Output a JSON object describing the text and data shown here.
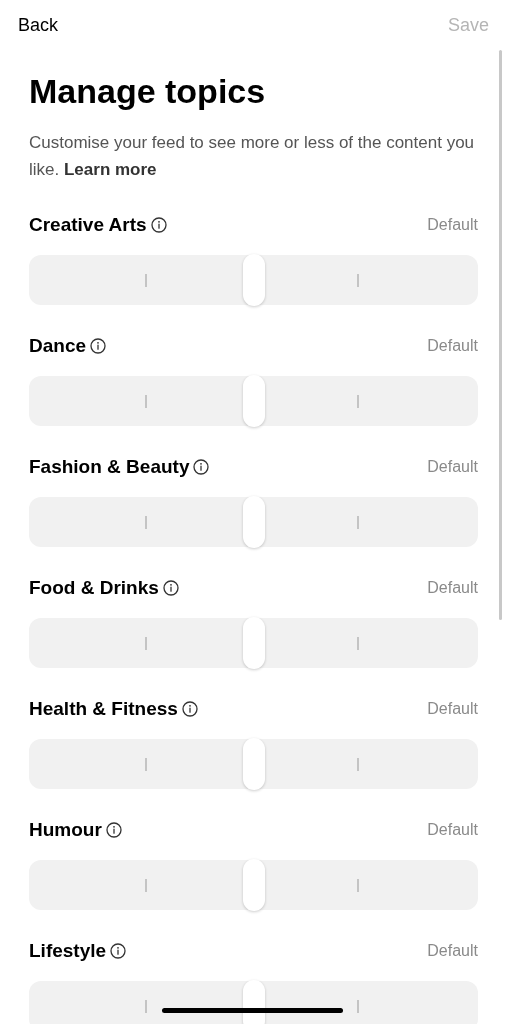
{
  "header": {
    "back": "Back",
    "save": "Save",
    "save_disabled": true
  },
  "title": "Manage topics",
  "description": "Customise your feed to see more or less of the content you like. **Learn more**",
  "topics": [
    {
      "name": "Creative Arts",
      "value": "Default",
      "level": 0.5
    },
    {
      "name": "Dance",
      "value": "Default",
      "level": 0.5
    },
    {
      "name": "Fashion & Beauty",
      "value": "Default",
      "level": 0.5
    },
    {
      "name": "Food & Drinks",
      "value": "Default",
      "level": 0.5
    },
    {
      "name": "Health & Fitness",
      "value": "Default",
      "level": 0.5
    },
    {
      "name": "Humour",
      "value": "Default",
      "level": 0.5
    },
    {
      "name": "Lifestyle",
      "value": "Default",
      "level": 0.5
    }
  ]
}
